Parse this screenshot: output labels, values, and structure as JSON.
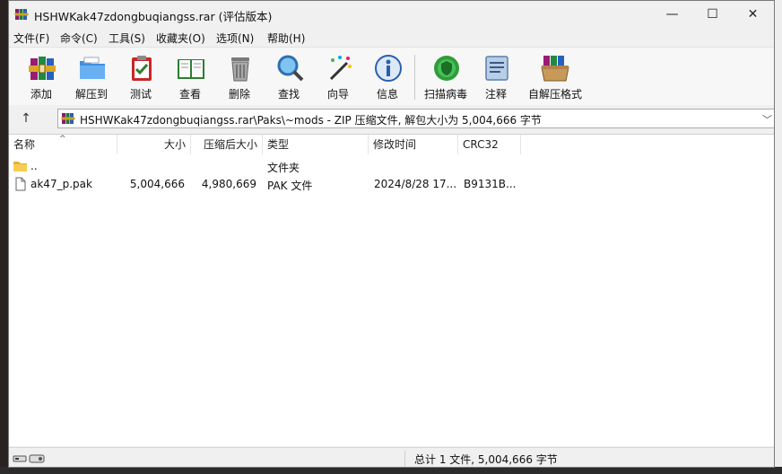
{
  "window": {
    "title": "HSHWKak47zdongbuqiangss.rar (评估版本)",
    "minimize_glyph": "—",
    "maximize_glyph": "☐",
    "close_glyph": "✕"
  },
  "menu": [
    "文件(F)",
    "命令(C)",
    "工具(S)",
    "收藏夹(O)",
    "选项(N)",
    "帮助(H)"
  ],
  "toolbar": [
    {
      "label": "添加",
      "icon": "winrar-books-icon"
    },
    {
      "label": "解压到",
      "icon": "folder-extract-icon"
    },
    {
      "label": "测试",
      "icon": "clipboard-check-icon"
    },
    {
      "label": "查看",
      "icon": "open-book-icon"
    },
    {
      "label": "删除",
      "icon": "trash-can-icon"
    },
    {
      "label": "查找",
      "icon": "magnifier-icon"
    },
    {
      "label": "向导",
      "icon": "magic-wand-icon"
    },
    {
      "label": "信息",
      "icon": "info-icon"
    },
    {
      "label": "扫描病毒",
      "icon": "virus-scan-icon"
    },
    {
      "label": "注释",
      "icon": "comment-icon"
    },
    {
      "label": "自解压格式",
      "icon": "sfx-box-icon"
    }
  ],
  "address": {
    "up_glyph": "↑",
    "path": "HSHWKak47zdongbuqiangss.rar\\Paks\\~mods - ZIP 压缩文件, 解包大小为 5,004,666 字节",
    "dropdown_glyph": "﹀"
  },
  "columns": {
    "name": "名称",
    "size": "大小",
    "packed": "压缩后大小",
    "type": "类型",
    "modified": "修改时间",
    "crc": "CRC32",
    "sort_glyph": "^"
  },
  "rows": [
    {
      "name": "..",
      "size": "",
      "packed": "",
      "type": "文件夹",
      "modified": "",
      "crc": "",
      "kind": "folder"
    },
    {
      "name": "ak47_p.pak",
      "size": "5,004,666",
      "packed": "4,980,669",
      "type": "PAK 文件",
      "modified": "2024/8/28 17...",
      "crc": "B9131B...",
      "kind": "file"
    }
  ],
  "status": {
    "text": "总计 1 文件, 5,004,666 字节"
  }
}
